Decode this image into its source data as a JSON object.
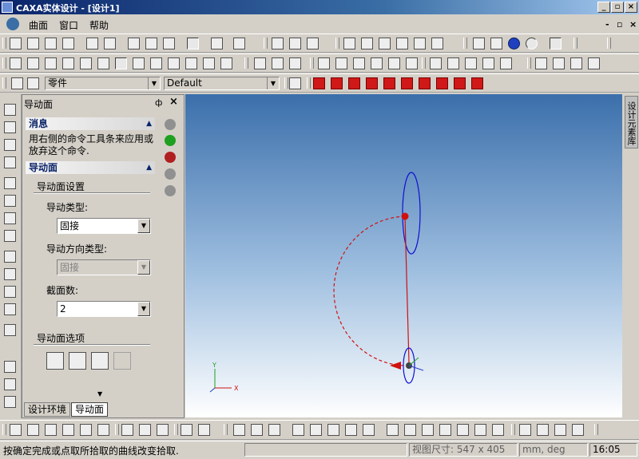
{
  "window": {
    "title": "CAXA实体设计 - [设计1]",
    "minimize_label": "_",
    "restore_label": "▫",
    "close_label": "×"
  },
  "menu": {
    "items": [
      "曲面",
      "窗口",
      "帮助"
    ],
    "doc_minimize": "-",
    "doc_restore": "▫",
    "doc_close": "×"
  },
  "toolbar3": {
    "object_type": "零件",
    "style": "Default"
  },
  "panel": {
    "title": "导动面",
    "pin_label": "ф",
    "close_label": "×",
    "message_header": "消息",
    "message_text_line1": "用右侧的命令工具条来应用或",
    "message_text_line2": "放弃这个命令.",
    "section_header": "导动面",
    "group_settings": "导动面设置",
    "guide_type_label": "导动类型:",
    "guide_type_value": "固接",
    "guide_dir_label": "导动方向类型:",
    "guide_dir_value": "固接",
    "section_count_label": "截面数:",
    "section_count_value": "2",
    "options_label": "导动面选项"
  },
  "tabs": [
    "设计环境",
    "导动面"
  ],
  "right_tab": "设计元素库",
  "axes": {
    "x": "X",
    "y": "Y"
  },
  "status": {
    "message": "按确定完成或点取所拾取的曲线改变拾取.",
    "view_size_label": "视图尺寸: 547 x 405",
    "units": "mm, deg",
    "time": "16:05"
  },
  "colors": {
    "curve": "#d01010",
    "ellipse": "#1010d0",
    "sidebtn_ok": "#20a020",
    "sidebtn_cancel": "#b02020"
  }
}
